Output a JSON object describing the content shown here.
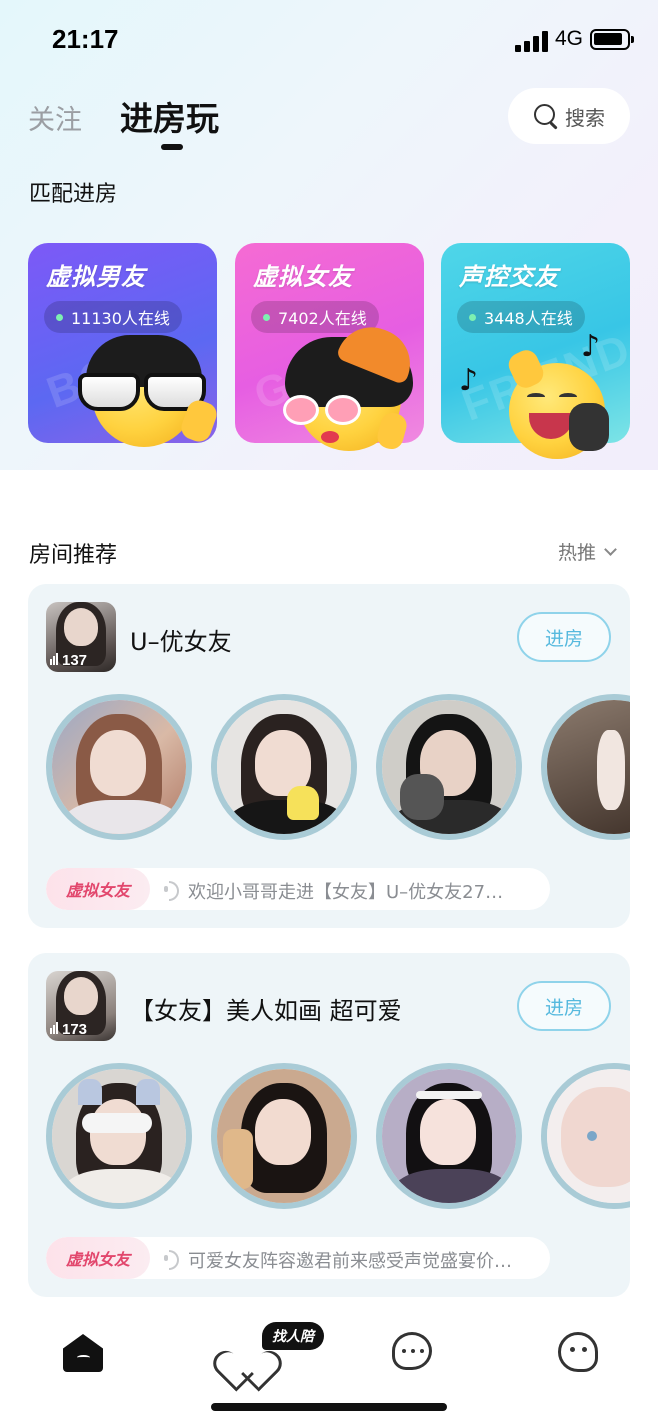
{
  "status": {
    "time": "21:17",
    "network": "4G"
  },
  "header": {
    "tabs": [
      {
        "label": "关注"
      },
      {
        "label": "进房玩"
      }
    ],
    "search_label": "搜索"
  },
  "match": {
    "title": "匹配进房",
    "cards": [
      {
        "title": "虚拟男友",
        "online": "11130人在线"
      },
      {
        "title": "虚拟女友",
        "online": "7402人在线"
      },
      {
        "title": "声控交友",
        "online": "3448人在线"
      }
    ]
  },
  "rooms": {
    "title": "房间推荐",
    "sort_label": "热推",
    "list": [
      {
        "name": "U–优女友",
        "count": "137",
        "enter_label": "进房",
        "tag": "虚拟女友",
        "message": "欢迎小哥哥走进【女友】U–优女友27…"
      },
      {
        "name": "【女友】美人如画 超可爱",
        "count": "173",
        "enter_label": "进房",
        "tag": "虚拟女友",
        "message": "可爱女友阵容邀君前来感受声觉盛宴价…"
      }
    ]
  },
  "nav": {
    "items": [
      {
        "icon": "home-icon"
      },
      {
        "icon": "heart-icon"
      },
      {
        "icon": "chat-icon"
      },
      {
        "icon": "profile-icon"
      }
    ],
    "badge": "找人陪"
  },
  "colors": {
    "accent": "#56b9de",
    "tag_text": "#e2476d",
    "card_bg": "#eef5f8"
  }
}
